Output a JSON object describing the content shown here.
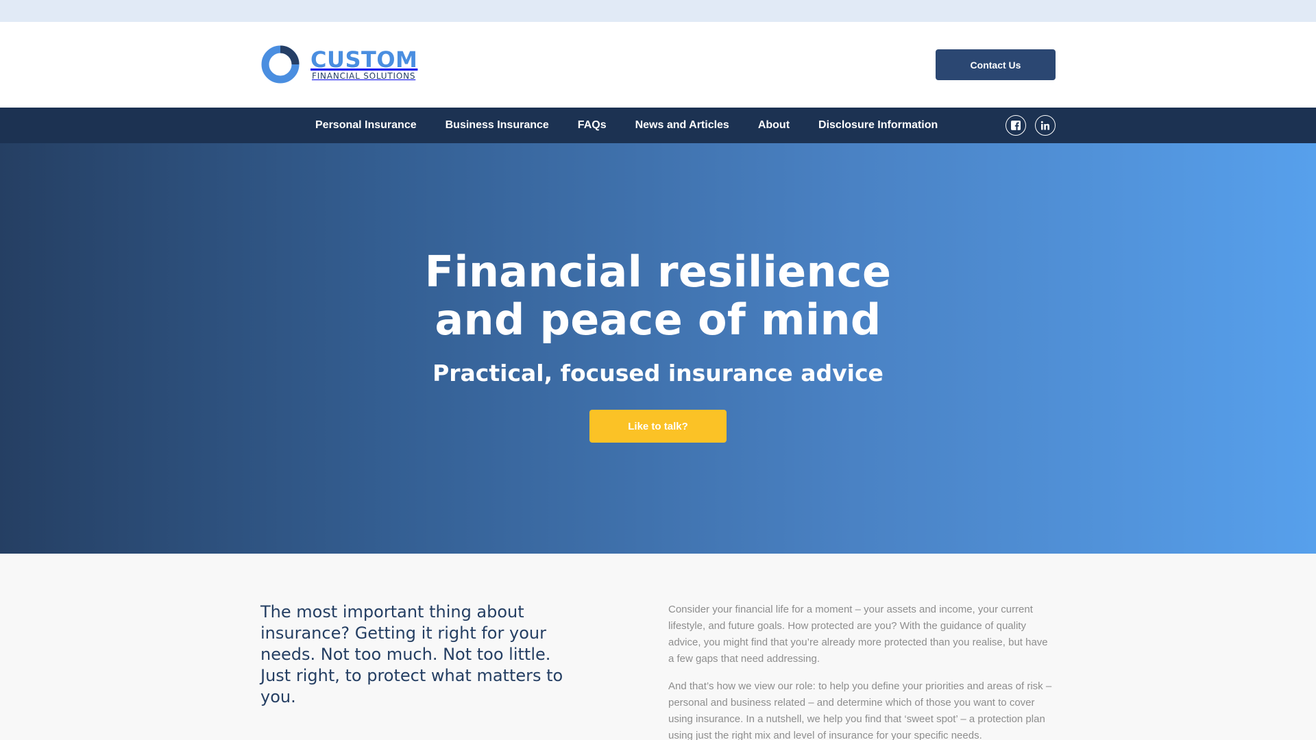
{
  "logo": {
    "name": "CUSTOM",
    "tagline": "FINANCIAL SOLUTIONS",
    "ring_color": "#4a8ee0",
    "ring_accent_color": "#253f66"
  },
  "header": {
    "contact_label": "Contact Us"
  },
  "nav": {
    "items": [
      {
        "label": "Personal Insurance"
      },
      {
        "label": "Business Insurance"
      },
      {
        "label": "FAQs"
      },
      {
        "label": "News and Articles"
      },
      {
        "label": "About"
      },
      {
        "label": "Disclosure Information"
      }
    ],
    "social": [
      {
        "icon": "facebook-icon"
      },
      {
        "icon": "linkedin-icon"
      }
    ]
  },
  "hero": {
    "title_line1": "Financial resilience",
    "title_line2": "and peace of mind",
    "subtitle": "Practical, focused insurance advice",
    "cta_label": "Like to talk?"
  },
  "content": {
    "lead": "The most important thing about insurance? Getting it right for your needs. Not too much. Not too little. Just right, to protect what matters to you.",
    "paragraphs": [
      "Consider your financial life for a moment – your assets and income, your current lifestyle, and future goals. How protected are you? With the guidance of quality advice, you might find that you’re already more protected than you realise, but have a few gaps that need addressing.",
      "And that’s how we view our role: to help you define your priorities and areas of risk – personal and business related – and determine which of those you want to cover using insurance. In a nutshell, we help you find that ‘sweet spot’ – a protection plan using just the right mix and level of insurance for your specific needs."
    ]
  },
  "colors": {
    "top_strip": "#e1eaf6",
    "nav_bg": "#1c3252",
    "primary_button": "#2b4772",
    "cta_button": "#fbc226",
    "hero_gradient_start": "#253f63",
    "hero_gradient_end": "#57a0ec"
  }
}
